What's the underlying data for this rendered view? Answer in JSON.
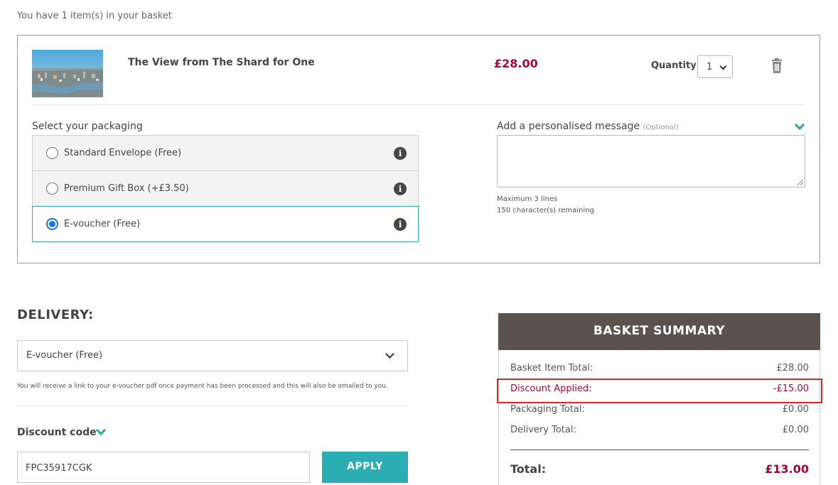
{
  "basket": {
    "count_text": "You have 1 item(s) in your basket"
  },
  "item": {
    "title": "The View from The Shard for One",
    "price": "£28.00",
    "quantity_label": "Quantity:",
    "quantity_value": "1",
    "thumbnail_icon": "london-skyline-photo",
    "delete_icon": "trash-icon"
  },
  "packaging": {
    "heading": "Select your packaging",
    "options": [
      {
        "label": "Standard Envelope (Free)",
        "selected": false
      },
      {
        "label": "Premium Gift Box (+£3.50)",
        "selected": false
      },
      {
        "label": "E-voucher (Free)",
        "selected": true
      }
    ],
    "info_glyph": "i"
  },
  "message": {
    "heading": "Add a personalised message",
    "optional": "(Optional)",
    "value": "",
    "max_lines": "Maximum 3 lines",
    "remaining": "150 character(s) remaining"
  },
  "delivery": {
    "heading": "DELIVERY:",
    "selected": "E-voucher (Free)",
    "note": "You will receive a link to your e-voucher pdf once payment has been processed and this will also be emailed to you."
  },
  "discount": {
    "heading": "Discount code",
    "code": "FPC35917CGK",
    "apply_label": "APPLY"
  },
  "summary": {
    "heading": "BASKET SUMMARY",
    "rows": [
      {
        "label": "Basket Item Total:",
        "amount": "£28.00"
      },
      {
        "label": "Discount Applied:",
        "amount": "-£15.00"
      },
      {
        "label": "Packaging Total:",
        "amount": "£0.00"
      },
      {
        "label": "Delivery Total:",
        "amount": "£0.00"
      }
    ],
    "total_label": "Total:",
    "total_amount": "£13.00"
  },
  "colors": {
    "accent_teal": "#2aaeb3",
    "price_red": "#a3053f",
    "summary_header": "#5b524e",
    "highlight_red": "#e0261f"
  }
}
